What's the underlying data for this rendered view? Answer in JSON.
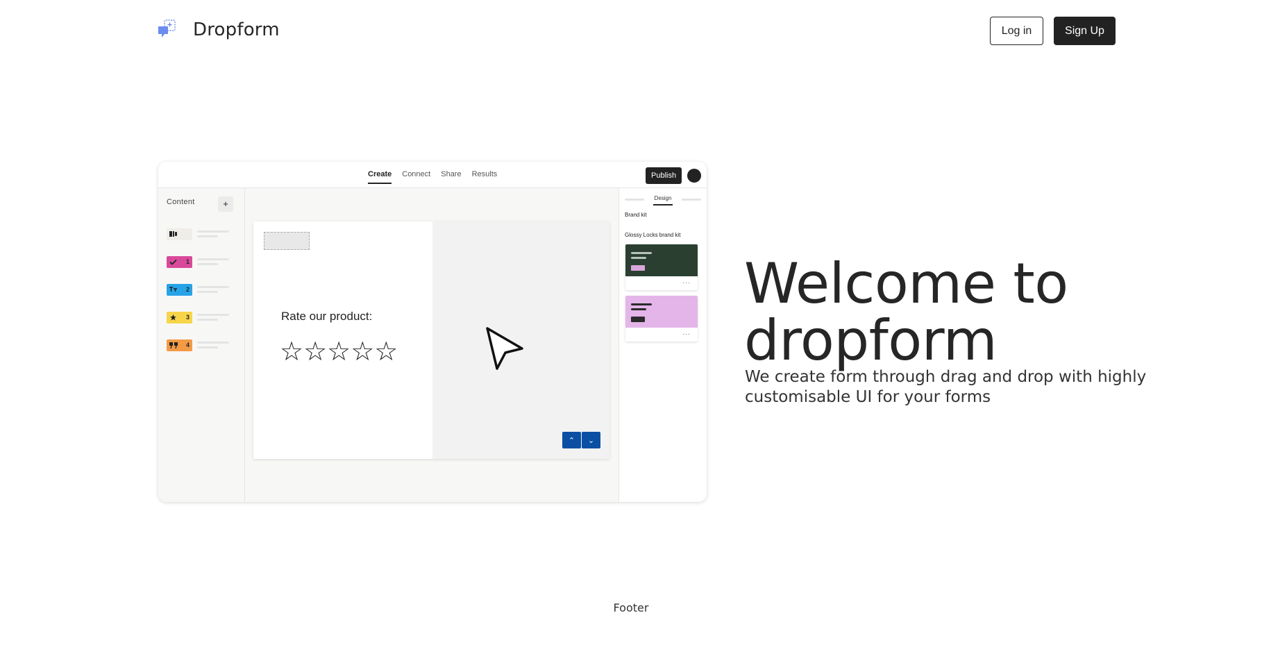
{
  "header": {
    "brand_name": "Dropform",
    "login_label": "Log in",
    "signup_label": "Sign Up"
  },
  "preview": {
    "tabs": [
      "Create",
      "Connect",
      "Share",
      "Results"
    ],
    "active_tab": "Create",
    "publish_label": "Publish",
    "content_label": "Content",
    "add_label": "+",
    "content_items": [
      {
        "color": "#efede8",
        "number": ""
      },
      {
        "color": "#d8499b",
        "number": "1"
      },
      {
        "color": "#27a3e8",
        "number": "2"
      },
      {
        "color": "#f7d54a",
        "number": "3"
      },
      {
        "color": "#f39a46",
        "number": "4"
      }
    ],
    "question": "Rate our product:",
    "stars": "☆☆☆☆☆",
    "side_tab": "Design",
    "brand_kit_label": "Brand kit",
    "glossy_label": "Glossy Locks brand kit",
    "kits": [
      {
        "bg": "#2a3f30",
        "line": "#b7c3b9",
        "button": "#d9a6db"
      },
      {
        "bg": "#e4b5e8",
        "line": "#2b2b2b",
        "button": "#2b2b2b"
      }
    ],
    "more_label": "···",
    "nav_up": "⌃",
    "nav_down": "⌄"
  },
  "hero": {
    "title": "Welcome to dropform",
    "subtitle": "We create form through drag and drop with highly customisable UI for your forms"
  },
  "footer": {
    "text": "Footer"
  }
}
